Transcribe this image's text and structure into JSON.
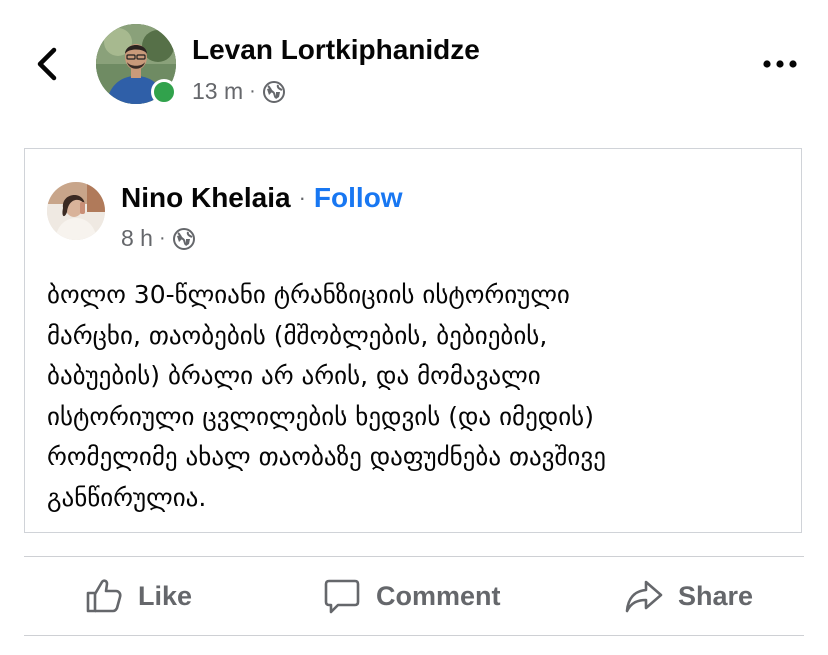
{
  "post": {
    "author": "Levan Lortkiphanidze",
    "time": "13 m",
    "sep": "·",
    "audience_icon": "globe-icon",
    "online_status_color": "#31a24c"
  },
  "shared": {
    "author": "Nino Khelaia",
    "sep": "·",
    "follow_label": "Follow",
    "time": "8 h",
    "audience_icon": "globe-icon",
    "text": "ბოლო 30-წლიანი ტრანზიციის ისტორიული\nმარცხი, თაობების (მშობლების, ბებიების,\nბაბუების) ბრალი არ არის, და მომავალი\nისტორიული ცვლილების ხედვის (და იმედის)\nრომელიმე ახალ თაობაზე დაფუძნება თავშივე\nგანწირულია."
  },
  "actions": {
    "like_label": "Like",
    "comment_label": "Comment",
    "share_label": "Share"
  },
  "colors": {
    "accent": "#1877f2",
    "secondary_text": "#65676b",
    "divider": "#ced0d4"
  }
}
